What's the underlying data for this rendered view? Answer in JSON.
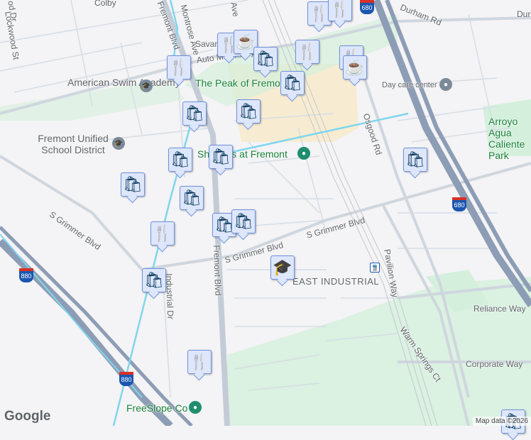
{
  "roads": {
    "fremont_blvd": "Fremont Blvd",
    "fremont_blvd_2": "Fremont Blvd",
    "s_grimmer_1": "S Grimmer Blvd",
    "s_grimmer_2": "S Grimmer Blvd",
    "s_grimmer_3": "S Grimmer Blvd",
    "osgood": "Osgood Rd",
    "durham": "Durham Rd",
    "durham_2": "Dur",
    "auto_mall": "Auto Mall Pkwy",
    "montrose": "Montrose Ave",
    "industrial": "Industrial Dr",
    "pavilion": "Pavilion Way",
    "reliance": "Reliance Way",
    "warm_springs": "Warm Springs Ct",
    "corporate": "Corporate Way",
    "colby": "Colby",
    "savannah": "Savannah",
    "ave": "Ave",
    "wood": "Lockwood St",
    "dr": "od Dr"
  },
  "places": {
    "american_swim": "American Swim Academy",
    "fremont_unified": "Fremont Unified School District",
    "peak": "The Peak of Fremont",
    "shoppes": "Shoppes at Fremont",
    "day_care": "Day care center",
    "arroyo": "Arroyo Agua Caliente Park",
    "east_industrial": "EAST INDUSTRIAL",
    "freeslope": "FreeSlope Co"
  },
  "highways": {
    "i680": "680",
    "i680b": "680",
    "i880": "880",
    "i880b": "880"
  },
  "markers": [
    {
      "type": "restaurant-icon",
      "glyph": "🍴"
    },
    {
      "type": "restaurant-icon",
      "glyph": "🍴"
    },
    {
      "type": "restaurant-icon",
      "glyph": "🍴"
    },
    {
      "type": "restaurant-icon",
      "glyph": "🍴"
    },
    {
      "type": "restaurant-icon",
      "glyph": "🍴"
    },
    {
      "type": "restaurant-icon",
      "glyph": "🍴"
    },
    {
      "type": "restaurant-icon",
      "glyph": "🍴"
    },
    {
      "type": "cafe-icon",
      "glyph": "☕"
    },
    {
      "type": "cafe-icon",
      "glyph": "☕"
    },
    {
      "type": "shopping-bag-icon",
      "glyph": "👜"
    }
  ],
  "glyphs": {
    "fork": "🍴",
    "cup": "☕",
    "bag": "🛍",
    "school": "🎓",
    "pin": "●",
    "train": "🚆"
  },
  "footer": {
    "logo": "Google",
    "attribution": "Map data ©2026"
  }
}
